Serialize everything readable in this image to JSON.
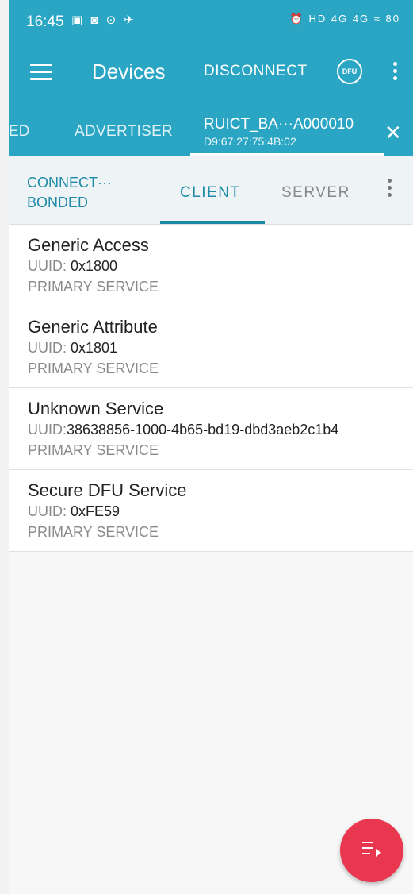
{
  "statusbar": {
    "time": "16:45",
    "left_icons": "▣ ◙ ⊙ ✈",
    "right_icons": "⏰ HD 4G 4G ≈ 80"
  },
  "appbar": {
    "title": "Devices",
    "disconnect": "DISCONNECT",
    "dfu": "DFU"
  },
  "tabs": {
    "partial": "ED",
    "advertiser": "ADVERTISER",
    "device_name": "RUICT_BA···A000010",
    "device_addr": "D9:67:27:75:4B:02"
  },
  "subbar": {
    "state_line1": "CONNECT···",
    "state_line2": "BONDED",
    "client": "CLIENT",
    "server": "SERVER"
  },
  "services": [
    {
      "name": "Generic Access",
      "uuid_label": "UUID: ",
      "uuid": "0x1800",
      "type": "PRIMARY SERVICE"
    },
    {
      "name": "Generic Attribute",
      "uuid_label": "UUID: ",
      "uuid": "0x1801",
      "type": "PRIMARY SERVICE"
    },
    {
      "name": "Unknown Service",
      "uuid_label": "UUID: ",
      "uuid": "38638856-1000-4b65-bd19-dbd3aeb2c1b4",
      "type": "PRIMARY SERVICE"
    },
    {
      "name": "Secure DFU Service",
      "uuid_label": "UUID: ",
      "uuid": "0xFE59",
      "type": "PRIMARY SERVICE"
    }
  ],
  "colors": {
    "accent": "#2aa6c4",
    "tab_active": "#1d8aa8",
    "fab": "#e8374f"
  }
}
